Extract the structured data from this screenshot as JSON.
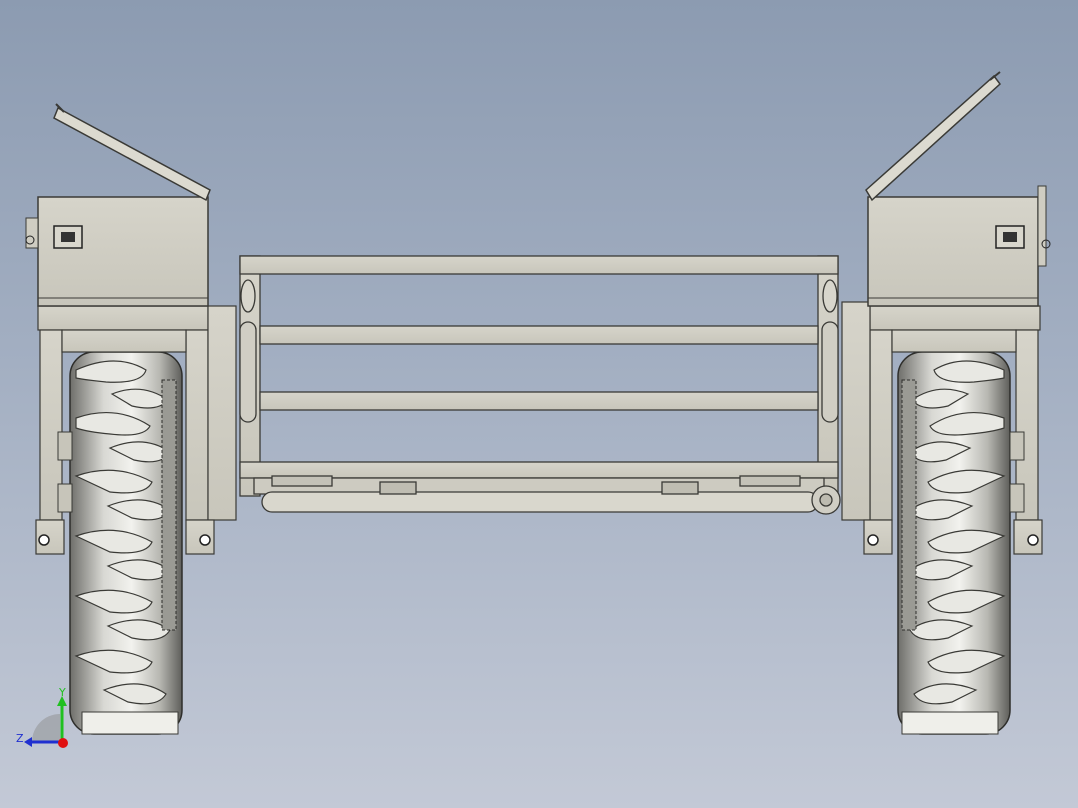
{
  "viewport": {
    "background_top": "#8c9bb1",
    "background_bottom": "#c3c9d6"
  },
  "model": {
    "part_color": "#cfcdc2",
    "edge_color": "#3a3a36",
    "tire_color": "#c9c9c4"
  },
  "triad": {
    "axes": [
      {
        "label": "Y",
        "color": "#20c020"
      },
      {
        "label": "Z",
        "color": "#2030d0"
      }
    ],
    "origin_color": "#e01010"
  }
}
